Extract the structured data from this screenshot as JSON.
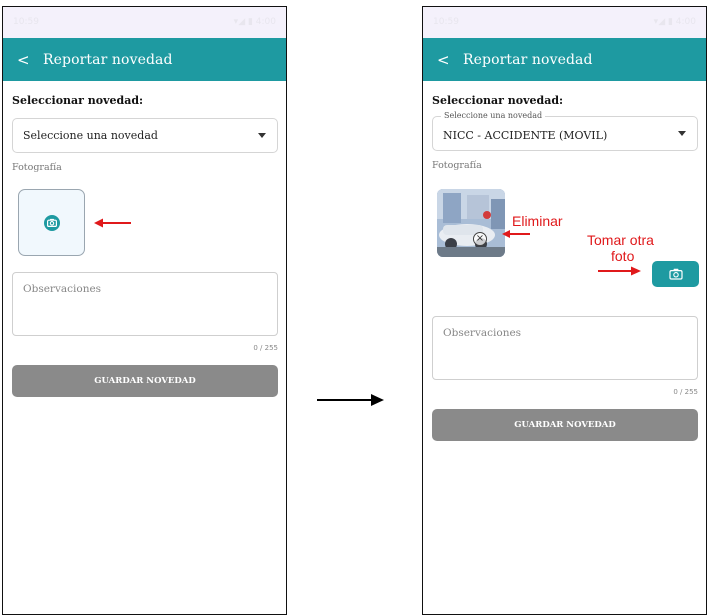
{
  "screen_left": {
    "status": {
      "time": "10:59",
      "icons": "▾◢ ▮ 4:00"
    },
    "appbar": {
      "back_icon": "chevron-left-icon",
      "title": "Reportar novedad"
    },
    "form": {
      "section_label": "Seleccionar novedad:",
      "select_placeholder": "Seleccione una novedad",
      "photo_label": "Fotografía",
      "observations_placeholder": "Observaciones",
      "counter": "0 / 255",
      "save_label": "GUARDAR NOVEDAD"
    }
  },
  "screen_right": {
    "status": {
      "time": "10:59",
      "icons": "▾◢ ▮ 4:00"
    },
    "appbar": {
      "back_icon": "chevron-left-icon",
      "title": "Reportar novedad"
    },
    "form": {
      "section_label": "Seleccionar novedad:",
      "select_floating_label": "Seleccione una novedad",
      "select_value": "NICC -  ACCIDENTE (MOVIL)",
      "photo_label": "Fotografía",
      "observations_placeholder": "Observaciones",
      "counter": "0 / 255",
      "save_label": "GUARDAR NOVEDAD"
    },
    "annotations": {
      "delete": "Eliminar",
      "retake_line1": "Tomar otra",
      "retake_line2": "foto"
    }
  },
  "colors": {
    "accent": "#1e9aa1",
    "annotation": "#e0191b",
    "button_disabled": "#8a8a8a"
  }
}
